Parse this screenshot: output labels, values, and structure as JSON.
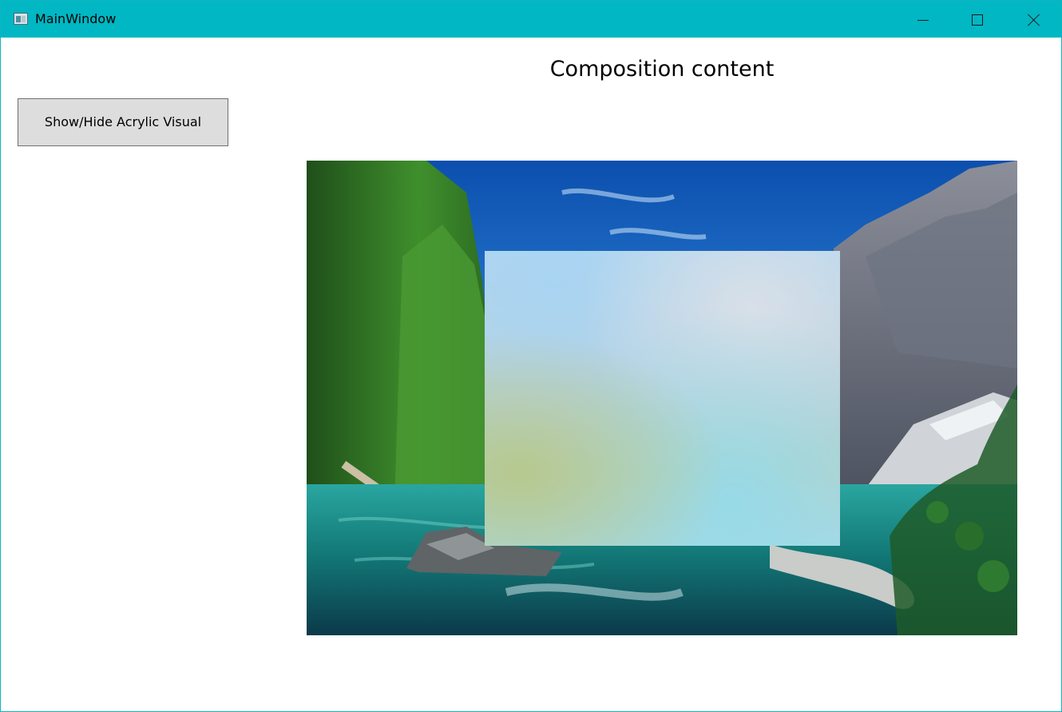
{
  "window": {
    "title": "MainWindow",
    "icon": "app-window-icon",
    "accent_color": "#00b7c3",
    "controls": {
      "minimize_icon": "minimize-icon",
      "maximize_icon": "maximize-icon",
      "close_icon": "close-icon"
    }
  },
  "main": {
    "heading": "Composition content",
    "toggle_button_label": "Show/Hide Acrylic Visual",
    "scene_description_icon": "mountain-lake-photo",
    "acrylic_panel_visible": true
  }
}
